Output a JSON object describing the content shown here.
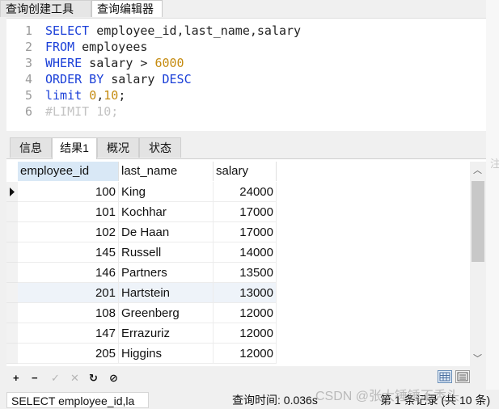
{
  "tabs": {
    "query_builder": "查询创建工具",
    "query_editor": "查询编辑器"
  },
  "editor": {
    "lines": [
      {
        "n": "1",
        "parts": [
          {
            "t": "SELECT",
            "c": "kw"
          },
          {
            "t": " employee_id,last_name,salary",
            "c": ""
          }
        ]
      },
      {
        "n": "2",
        "parts": [
          {
            "t": "FROM",
            "c": "kw"
          },
          {
            "t": " employees",
            "c": ""
          }
        ]
      },
      {
        "n": "3",
        "parts": [
          {
            "t": "WHERE",
            "c": "kw"
          },
          {
            "t": " salary > ",
            "c": ""
          },
          {
            "t": "6000",
            "c": "num"
          }
        ]
      },
      {
        "n": "4",
        "parts": [
          {
            "t": "ORDER BY",
            "c": "kw"
          },
          {
            "t": " salary ",
            "c": ""
          },
          {
            "t": "DESC",
            "c": "kw"
          }
        ]
      },
      {
        "n": "5",
        "parts": [
          {
            "t": "limit",
            "c": "kw"
          },
          {
            "t": " ",
            "c": ""
          },
          {
            "t": "0",
            "c": "num"
          },
          {
            "t": ",",
            "c": ""
          },
          {
            "t": "10",
            "c": "num"
          },
          {
            "t": ";",
            "c": ""
          }
        ]
      },
      {
        "n": "6",
        "parts": [
          {
            "t": "#LIMIT 10;",
            "c": "cm"
          }
        ]
      }
    ]
  },
  "result_tabs": [
    "信息",
    "结果1",
    "概况",
    "状态"
  ],
  "grid": {
    "columns": [
      "employee_id",
      "last_name",
      "salary"
    ],
    "rows": [
      [
        "100",
        "King",
        "24000"
      ],
      [
        "101",
        "Kochhar",
        "17000"
      ],
      [
        "102",
        "De Haan",
        "17000"
      ],
      [
        "145",
        "Russell",
        "14000"
      ],
      [
        "146",
        "Partners",
        "13500"
      ],
      [
        "201",
        "Hartstein",
        "13000"
      ],
      [
        "108",
        "Greenberg",
        "12000"
      ],
      [
        "147",
        "Errazuriz",
        "12000"
      ],
      [
        "205",
        "Higgins",
        "12000"
      ]
    ]
  },
  "toolbar": {
    "add": "+",
    "delete": "−",
    "apply": "✓",
    "cancel": "✕",
    "refresh": "↻",
    "stop": "⊘"
  },
  "status": {
    "sql": "SELECT employee_id,la",
    "query_time": "查询时间: 0.036s",
    "records": "第 1 条记录 (共 10 条)"
  },
  "watermark": "CSDN @张大锤锤不秃头",
  "edge_char": "注",
  "icons": {
    "row_pointer": "triangle-right",
    "scroll_up": "chevron-up",
    "scroll_down": "chevron-down",
    "grid_view": "grid-view-icon",
    "form_view": "form-view-icon"
  },
  "colors": {
    "keyword": "#1a3fd8",
    "number": "#c58b10",
    "comment": "#c3c3c3"
  }
}
